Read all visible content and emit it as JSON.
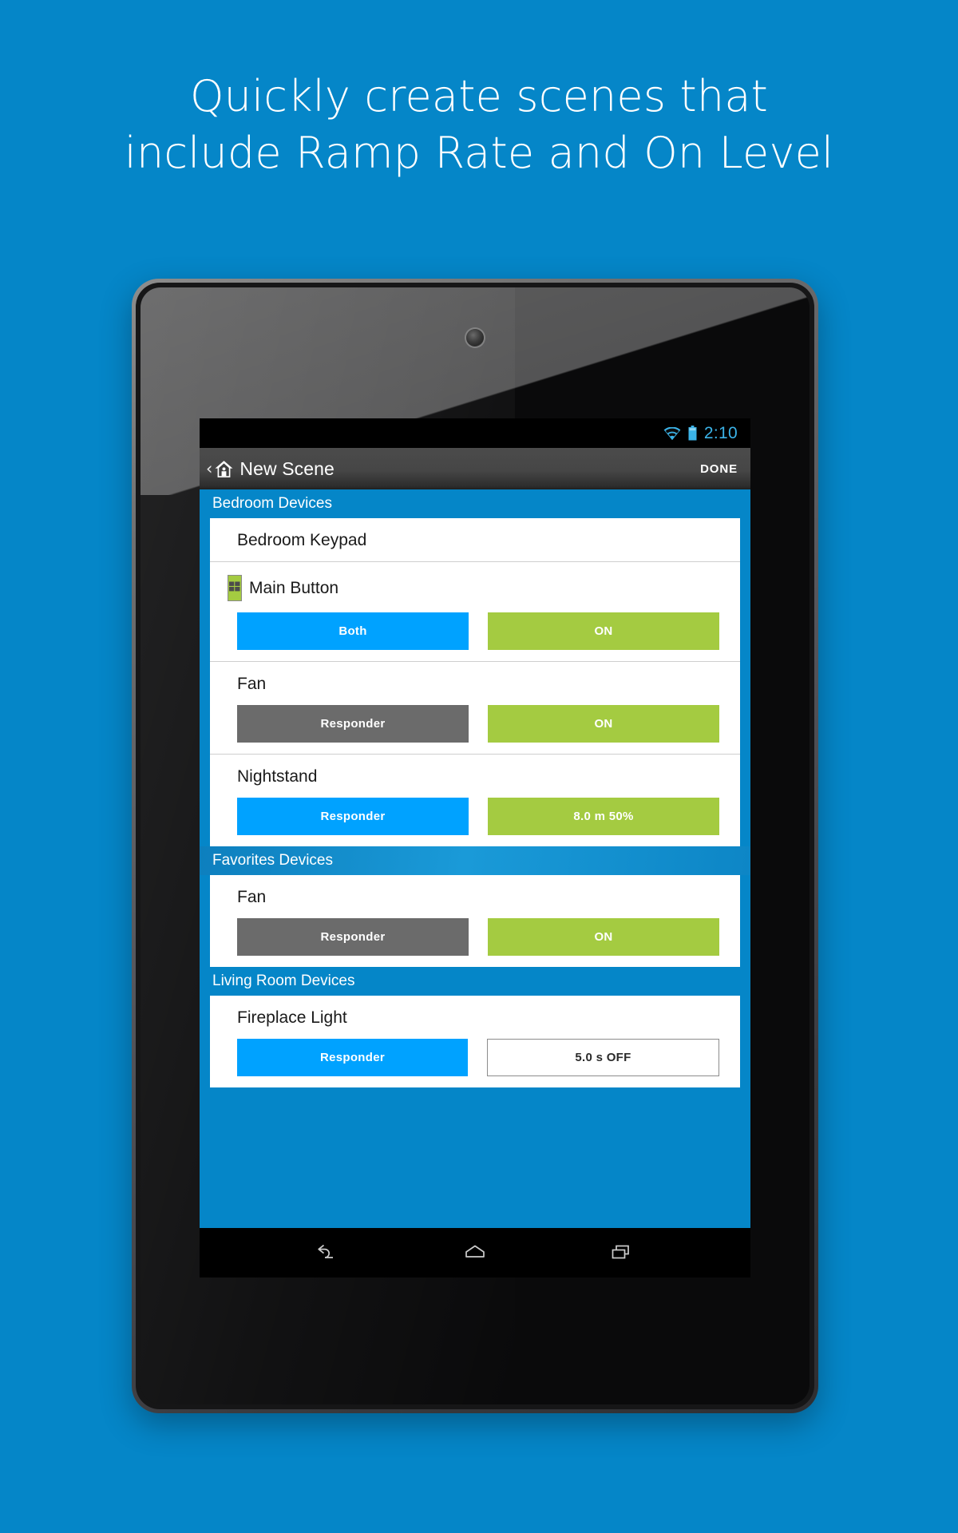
{
  "promo": {
    "headline_line1": "Quickly create scenes that",
    "headline_line2": "include Ramp Rate and On Level",
    "background_color": "#0586c8"
  },
  "statusbar": {
    "wifi_icon": "wifi-icon",
    "battery_icon": "battery-icon",
    "time": "2:10",
    "time_color": "#3bb3e8"
  },
  "actionbar": {
    "back_chevron": "‹",
    "home_icon": "home-icon",
    "title": "New Scene",
    "done_label": "DONE"
  },
  "colors": {
    "accent_blue": "#00a2ff",
    "accent_green": "#a4cb41",
    "responder_gray": "#6b6b6b",
    "header_blue": "#0586c8"
  },
  "sections": [
    {
      "header": "Bedroom Devices",
      "gradient": false,
      "devices": [
        {
          "name": "Bedroom Keypad",
          "icon": null,
          "has_buttons": false,
          "left_button": null,
          "right_button": null
        },
        {
          "name": "Main Button",
          "icon": "keypad-icon",
          "has_buttons": true,
          "left_button": {
            "label": "Both",
            "style": "blue"
          },
          "right_button": {
            "label": "ON",
            "style": "green"
          }
        },
        {
          "name": "Fan",
          "icon": null,
          "has_buttons": true,
          "left_button": {
            "label": "Responder",
            "style": "gray"
          },
          "right_button": {
            "label": "ON",
            "style": "green"
          }
        },
        {
          "name": "Nightstand",
          "icon": null,
          "has_buttons": true,
          "left_button": {
            "label": "Responder",
            "style": "blue"
          },
          "right_button": {
            "label": "8.0 m   50%",
            "style": "green"
          }
        }
      ]
    },
    {
      "header": "Favorites Devices",
      "gradient": true,
      "devices": [
        {
          "name": "Fan",
          "icon": null,
          "has_buttons": true,
          "left_button": {
            "label": "Responder",
            "style": "gray"
          },
          "right_button": {
            "label": "ON",
            "style": "green"
          }
        }
      ]
    },
    {
      "header": "Living Room Devices",
      "gradient": false,
      "devices": [
        {
          "name": "Fireplace Light",
          "icon": null,
          "has_buttons": true,
          "left_button": {
            "label": "Responder",
            "style": "blue"
          },
          "right_button": {
            "label": "5.0 s   OFF",
            "style": "white"
          }
        }
      ]
    }
  ],
  "navbar": {
    "back_icon": "back-arrow-icon",
    "home_icon": "home-nav-icon",
    "recents_icon": "recents-icon"
  }
}
